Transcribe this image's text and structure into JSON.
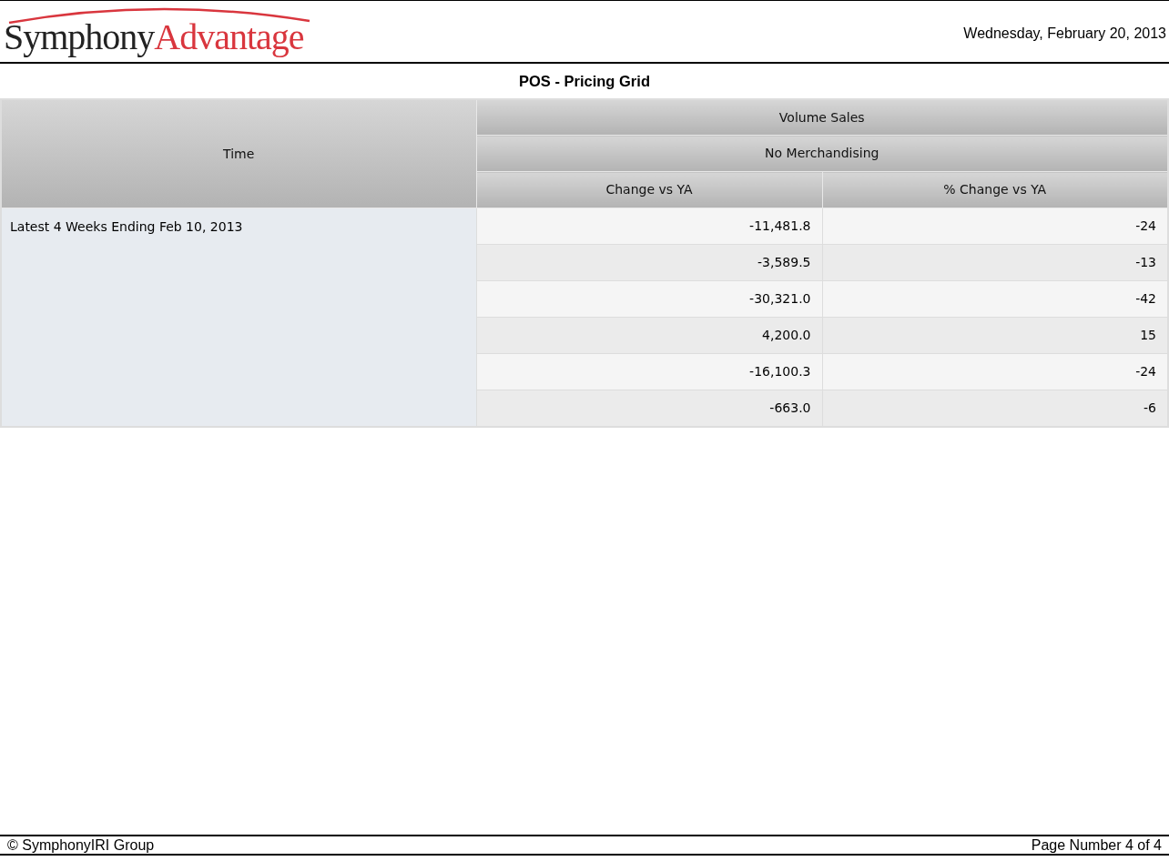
{
  "header": {
    "logo": {
      "dark": "Symphony",
      "accent": "Advantage"
    },
    "date": "Wednesday, February 20, 2013"
  },
  "report_title": "POS - Pricing Grid",
  "table": {
    "row_header": "Time",
    "group_headers": [
      "Volume Sales",
      "No Merchandising"
    ],
    "columns": [
      "Change vs YA",
      "% Change vs YA"
    ],
    "row_label": "Latest 4 Weeks Ending Feb 10, 2013",
    "rows": [
      [
        "-11,481.8",
        "-24"
      ],
      [
        "-3,589.5",
        "-13"
      ],
      [
        "-30,321.0",
        "-42"
      ],
      [
        "4,200.0",
        "15"
      ],
      [
        "-16,100.3",
        "-24"
      ],
      [
        "-663.0",
        "-6"
      ]
    ]
  },
  "footer": {
    "copyright": "© SymphonyIRI Group",
    "page_number": "Page Number 4 of 4"
  }
}
